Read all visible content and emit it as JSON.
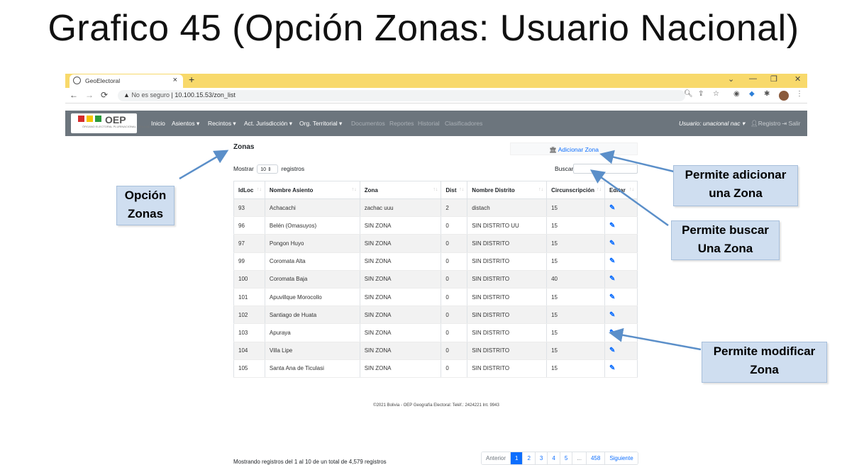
{
  "slide": {
    "title": "Grafico 45 (Opción Zonas: Usuario Nacional)"
  },
  "browser": {
    "tab_title": "GeoElectoral",
    "tab_close": "×",
    "new_tab": "+",
    "window_controls": [
      "⌄",
      "—",
      "❐",
      "✕"
    ],
    "url_prefix": "No es seguro",
    "url": "10.100.15.53/zon_list"
  },
  "navbar": {
    "logo_text": "OEP",
    "logo_subtext": "ÓRGANO ELECTORAL PLURINACIONAL · BOLIVIA",
    "items": [
      "Inicio",
      "Asientos ▾",
      "Recintos ▾",
      "Act. Jurisdicción ▾",
      "Org. Territorial ▾",
      "Documentos",
      "Reportes",
      "Historial",
      "Clasificadores"
    ],
    "user": "Usuario: unacional nac ▾",
    "registro": "Registro",
    "salir": "Salir"
  },
  "page": {
    "heading": "Zonas",
    "add_button": "Adicionar Zona",
    "show_label": "Mostrar",
    "show_value": "10",
    "records_label": "registros",
    "search_label": "Buscar",
    "info": "Mostrando registros del 1 al 10 de un total de 4,579 registros",
    "footer": "©2021 Bolivia - OEP Geografía Electoral: Teléf.: 2424221 Int. 9943"
  },
  "table": {
    "headers": [
      "IdLoc",
      "Nombre Asiento",
      "Zona",
      "Dist",
      "Nombre Distrito",
      "Circunscripción",
      "Editar"
    ],
    "rows": [
      [
        "93",
        "Achacachi",
        "zachac uuu",
        "2",
        "distach",
        "15"
      ],
      [
        "96",
        "Belén (Omasuyos)",
        "SIN ZONA",
        "0",
        "SIN DISTRITO UU",
        "15"
      ],
      [
        "97",
        "Pongon Huyo",
        "SIN ZONA",
        "0",
        "SIN DISTRITO",
        "15"
      ],
      [
        "99",
        "Coromata Alta",
        "SIN ZONA",
        "0",
        "SIN DISTRITO",
        "15"
      ],
      [
        "100",
        "Coromata Baja",
        "SIN ZONA",
        "0",
        "SIN DISTRITO",
        "40"
      ],
      [
        "101",
        "Apuvillque Morocollo",
        "SIN ZONA",
        "0",
        "SIN DISTRITO",
        "15"
      ],
      [
        "102",
        "Santiago de Huata",
        "SIN ZONA",
        "0",
        "SIN DISTRITO",
        "15"
      ],
      [
        "103",
        "Apuraya",
        "SIN ZONA",
        "0",
        "SIN DISTRITO",
        "15"
      ],
      [
        "104",
        "Villa Lipe",
        "SIN ZONA",
        "0",
        "SIN DISTRITO",
        "15"
      ],
      [
        "105",
        "Santa Ana de Ticulasi",
        "SIN ZONA",
        "0",
        "SIN DISTRITO",
        "15"
      ]
    ]
  },
  "pagination": [
    "Anterior",
    "1",
    "2",
    "3",
    "4",
    "5",
    "...",
    "458",
    "Siguiente"
  ],
  "callouts": {
    "opcion": [
      "Opción",
      "Zonas"
    ],
    "adicionar": [
      "Permite adicionar",
      "una Zona"
    ],
    "buscar": [
      "Permite buscar",
      "Una Zona"
    ],
    "modificar": [
      "Permite modificar",
      "Zona"
    ]
  },
  "colors": {
    "tabbar": "#f8d96b",
    "navbar": "#6c757d",
    "link": "#0d6efd",
    "callout": "#cfdef0",
    "arrow": "#5b8fc9"
  }
}
